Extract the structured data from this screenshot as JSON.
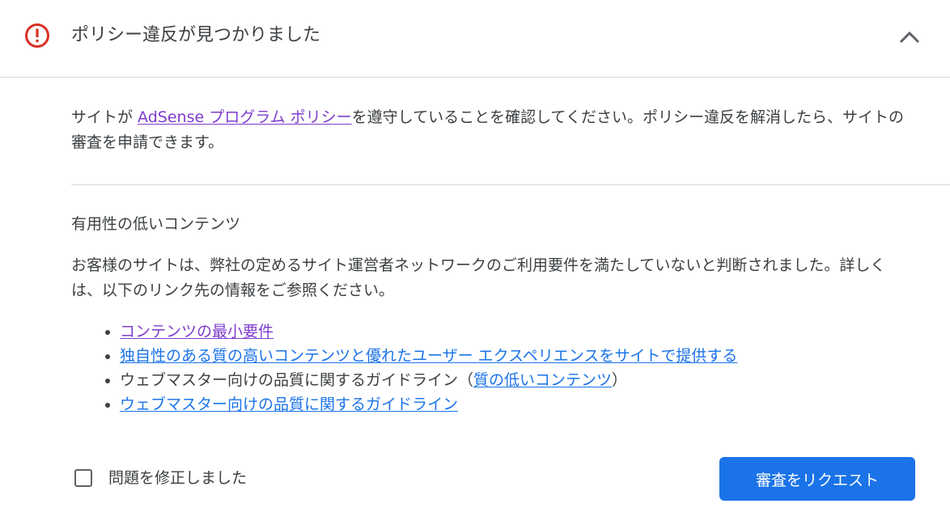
{
  "header": {
    "title": "ポリシー違反が見つかりました",
    "status_color": "#d93025"
  },
  "intro": {
    "prefix": "サイトが ",
    "link_text": "AdSense プログラム ポリシー",
    "suffix": "を遵守していることを確認してください。ポリシー違反を解消したら、サイトの審査を申請できます。"
  },
  "section": {
    "title": "有用性の低いコンテンツ",
    "description": "お客様のサイトは、弊社の定めるサイト運営者ネットワークのご利用要件を満たしていないと判断されました。詳しくは、以下のリンク先の情報をご参照ください。",
    "links": [
      {
        "text": "コンテンツの最小要件"
      },
      {
        "text": "独自性のある質の高いコンテンツと優れたユーザー エクスペリエンスをサイトで提供する"
      },
      {
        "prefix": "ウェブマスター向けの品質に関するガイドライン（",
        "link_text": "質の低いコンテンツ",
        "suffix": "）"
      },
      {
        "text": "ウェブマスター向けの品質に関するガイドライン"
      }
    ]
  },
  "footer": {
    "checkbox_label": "問題を修正しました",
    "request_button": "審査をリクエスト",
    "accent_color": "#1a73e8"
  },
  "icons": {
    "status": "error-circle-icon",
    "collapse": "chevron-up-icon",
    "checkbox": "checkbox-unchecked-icon"
  }
}
